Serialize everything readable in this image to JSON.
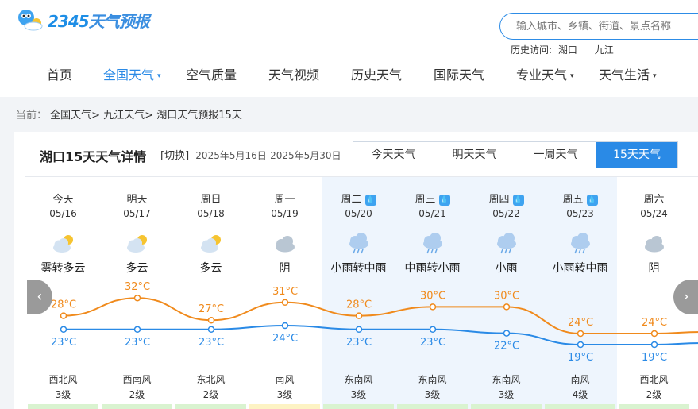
{
  "logo": {
    "digits": "2345",
    "name": "天气预报"
  },
  "search": {
    "placeholder": "输入城市、乡镇、街道、景点名称"
  },
  "history": {
    "label": "历史访问:",
    "cities": [
      "湖口",
      "九江"
    ]
  },
  "nav": [
    {
      "label": "首页",
      "active": false,
      "dropdown": false
    },
    {
      "label": "全国天气",
      "active": true,
      "dropdown": true
    },
    {
      "label": "空气质量",
      "active": false,
      "dropdown": false
    },
    {
      "label": "天气视频",
      "active": false,
      "dropdown": false
    },
    {
      "label": "历史天气",
      "active": false,
      "dropdown": false
    },
    {
      "label": "国际天气",
      "active": false,
      "dropdown": false
    },
    {
      "label": "专业天气",
      "active": false,
      "dropdown": true
    },
    {
      "label": "天气生活",
      "active": false,
      "dropdown": true
    }
  ],
  "breadcrumb": {
    "prefix": "当前：",
    "items": [
      "全国天气",
      "九江天气",
      "湖口天气预报15天"
    ],
    "sep": ">"
  },
  "card": {
    "title": "湖口15天天气详情",
    "switch_label": "[切换]",
    "date_range": "2025年5月16日-2025年5月30日",
    "tabs": [
      {
        "label": "今天天气",
        "active": false
      },
      {
        "label": "明天天气",
        "active": false
      },
      {
        "label": "一周天气",
        "active": false
      },
      {
        "label": "15天天气",
        "active": true
      }
    ]
  },
  "days": [
    {
      "name": "今天",
      "date": "05/16",
      "weather": "雾转多云",
      "icon": "partly-cloudy-icon",
      "rain": false,
      "high": 28,
      "low": 23,
      "wind": "西北风",
      "level": "3级"
    },
    {
      "name": "明天",
      "date": "05/17",
      "weather": "多云",
      "icon": "partly-cloudy-icon",
      "rain": false,
      "high": 32,
      "low": 23,
      "wind": "西南风",
      "level": "2级"
    },
    {
      "name": "周日",
      "date": "05/18",
      "weather": "多云",
      "icon": "partly-cloudy-icon",
      "rain": false,
      "high": 27,
      "low": 23,
      "wind": "东北风",
      "level": "2级"
    },
    {
      "name": "周一",
      "date": "05/19",
      "weather": "阴",
      "icon": "overcast-icon",
      "rain": false,
      "high": 31,
      "low": 24,
      "wind": "南风",
      "level": "3级"
    },
    {
      "name": "周二",
      "date": "05/20",
      "weather": "小雨转中雨",
      "icon": "rain-icon",
      "rain": true,
      "high": 28,
      "low": 23,
      "wind": "东南风",
      "level": "3级"
    },
    {
      "name": "周三",
      "date": "05/21",
      "weather": "中雨转小雨",
      "icon": "rain-icon",
      "rain": true,
      "high": 30,
      "low": 23,
      "wind": "东南风",
      "level": "3级"
    },
    {
      "name": "周四",
      "date": "05/22",
      "weather": "小雨",
      "icon": "rain-icon",
      "rain": true,
      "high": 30,
      "low": 22,
      "wind": "东南风",
      "level": "3级"
    },
    {
      "name": "周五",
      "date": "05/23",
      "weather": "小雨转中雨",
      "icon": "rain-icon",
      "rain": true,
      "high": 24,
      "low": 19,
      "wind": "南风",
      "level": "4级"
    },
    {
      "name": "周六",
      "date": "05/24",
      "weather": "阴",
      "icon": "overcast-icon",
      "rain": false,
      "high": 24,
      "low": 19,
      "wind": "西北风",
      "level": "2级"
    }
  ],
  "colors": {
    "high_line": "#f08a1c",
    "low_line": "#2a8ae6",
    "accent": "#2a8ae6",
    "rain_bg": "#eef5fd"
  },
  "arrows": {
    "left": "‹",
    "right": "›"
  }
}
